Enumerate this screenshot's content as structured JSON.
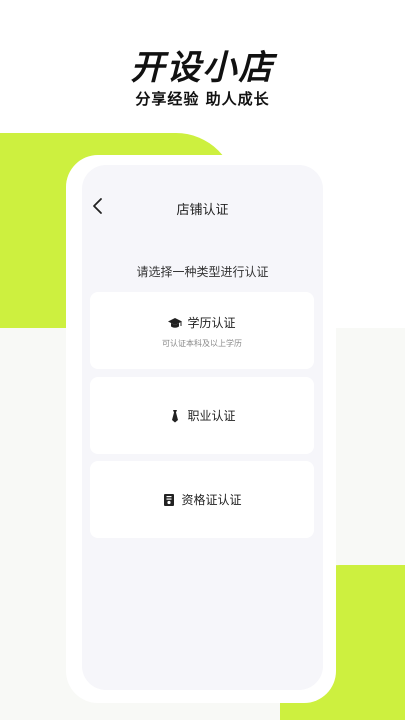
{
  "hero": {
    "title": "开设小店",
    "subtitle": "分享经验 助人成长"
  },
  "screen": {
    "nav_title": "店铺认证",
    "back_icon": "chevron-left-icon",
    "prompt": "请选择一种类型进行认证",
    "options": [
      {
        "icon": "graduation-cap-icon",
        "label": "学历认证",
        "note": "可认证本科及以上学历"
      },
      {
        "icon": "necktie-icon",
        "label": "职业认证"
      },
      {
        "icon": "certificate-icon",
        "label": "资格证认证"
      }
    ]
  },
  "colors": {
    "accent": "#cdf03f",
    "background": "#f8f9f6",
    "screen_bg": "#f6f6fa",
    "card": "#ffffff",
    "text": "#111111"
  }
}
